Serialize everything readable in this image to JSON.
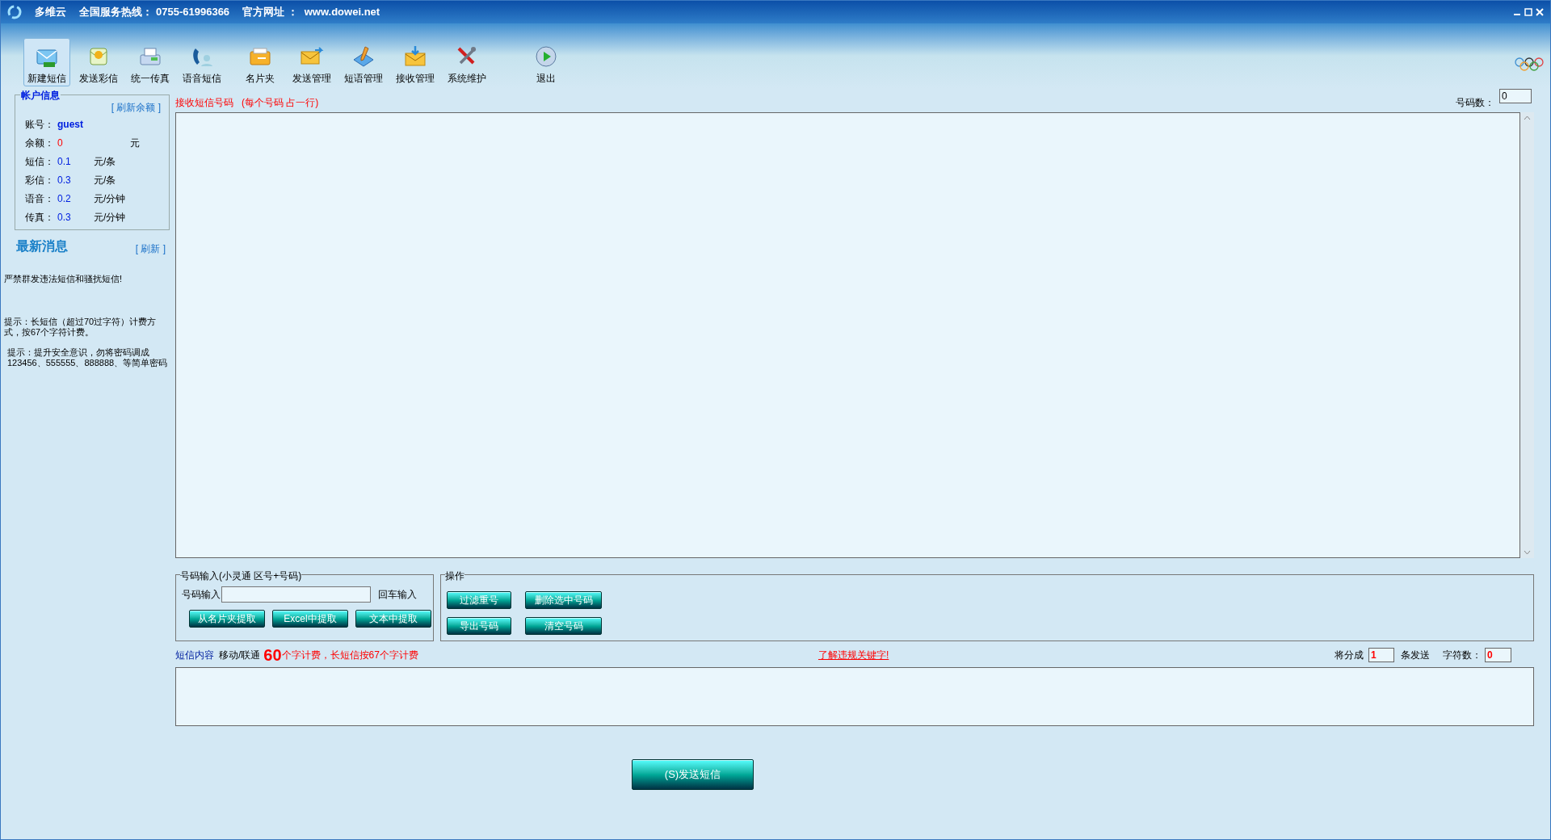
{
  "title_bar": {
    "app_name": "多维云",
    "hotline_label": "全国服务热线：",
    "hotline": "0755-61996366",
    "site_label": "官方网址 ：",
    "site": "www.dowei.net"
  },
  "toolbar": [
    {
      "label": "新建短信",
      "selected": true
    },
    {
      "label": "发送彩信",
      "selected": false
    },
    {
      "label": "统一传真",
      "selected": false
    },
    {
      "label": "语音短信",
      "selected": false
    },
    {
      "label": "名片夹",
      "selected": false
    },
    {
      "label": "发送管理",
      "selected": false
    },
    {
      "label": "短语管理",
      "selected": false
    },
    {
      "label": "接收管理",
      "selected": false
    },
    {
      "label": "系统维护",
      "selected": false
    },
    {
      "label": "退出",
      "selected": false
    }
  ],
  "account": {
    "title": "帐户信息",
    "refresh": "[ 刷新余额 ]",
    "rows": [
      {
        "label": "账号：",
        "value": "guest",
        "unit": "",
        "kind": "account"
      },
      {
        "label": "余额：",
        "value": "0",
        "unit": "元",
        "kind": "balance"
      },
      {
        "label": "短信：",
        "value": "0.1",
        "unit": "元/条",
        "kind": "price"
      },
      {
        "label": "彩信：",
        "value": "0.3",
        "unit": "元/条",
        "kind": "price"
      },
      {
        "label": "语音：",
        "value": "0.2",
        "unit": "元/分钟",
        "kind": "price"
      },
      {
        "label": "传真：",
        "value": "0.3",
        "unit": "元/分钟",
        "kind": "price"
      }
    ]
  },
  "news": {
    "title": "最新消息",
    "refresh": "[ 刷新 ]",
    "items": [
      "严禁群发违法短信和骚扰短信!",
      "提示：长短信（超过70过字符）计费方式，按67个字符计费。",
      "提示：提升安全意识，勿将密码调成123456、555555、888888、等简单密码"
    ]
  },
  "recipients": {
    "label": "接收短信号码",
    "hint": "(每个号码 占一行)",
    "count_label": "号码数：",
    "count": "0"
  },
  "number_input": {
    "title": "号码输入(小灵通 区号+号码)",
    "field_label": "号码输入",
    "enter_hint": "回车输入",
    "buttons": [
      "从名片夹提取",
      "Excel中提取",
      "文本中提取"
    ]
  },
  "operations": {
    "title": "操作",
    "buttons": [
      "过滤重号",
      "删除选中号码",
      "导出号码",
      "清空号码"
    ]
  },
  "content": {
    "label": "短信内容",
    "carrier": "移动/联通",
    "limit": "60",
    "limit_note": "个字计费，长短信按67个字计费",
    "keywords_link": "了解违规关键字!",
    "split_label": "将分成",
    "split": "1",
    "split_unit": "条发送",
    "chars_label": "字符数：",
    "chars": "0"
  },
  "send_button": "(S)发送短信"
}
